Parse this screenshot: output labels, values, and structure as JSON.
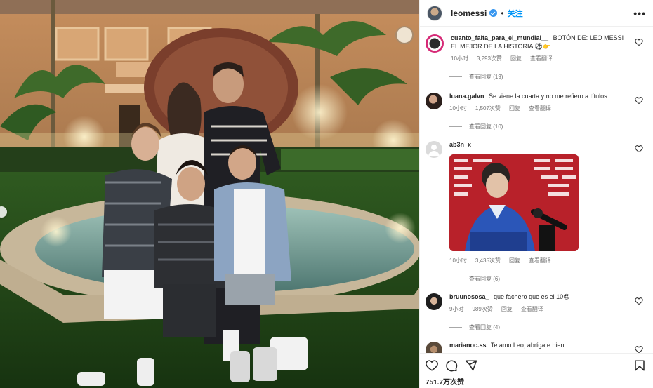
{
  "post": {
    "username": "leomessi",
    "follow_label": "关注",
    "more_label": "•••"
  },
  "comments": [
    {
      "username": "cuanto_falta_para_el_mundial__",
      "text": "BOTÓN DE: LEO MESSI EL MEJOR DE LA HISTORIA ⚽👉",
      "time": "10小时",
      "likes": "3,293次赞",
      "reply_label": "回复",
      "translate_label": "查看翻译",
      "view_replies": "查看回复 (19)"
    },
    {
      "username": "luana.galvn",
      "text": "Se viene la cuarta y no me refiero a títulos",
      "time": "10小时",
      "likes": "1,507次赞",
      "reply_label": "回复",
      "translate_label": "查看翻译",
      "view_replies": "查看回复 (10)"
    },
    {
      "username": "ab3n_x",
      "text": "",
      "time": "10小时",
      "likes": "3,435次赞",
      "reply_label": "回复",
      "translate_label": "查看翻译",
      "view_replies": "查看回复 (6)"
    },
    {
      "username": "bruunososa_",
      "text": "que fachero que es el 10😍",
      "time": "9小时",
      "likes": "989次赞",
      "reply_label": "回复",
      "translate_label": "查看翻译",
      "view_replies": "查看回复 (4)"
    },
    {
      "username": "marianoc.ss",
      "text": "Te amo Leo, abrígate bien"
    }
  ],
  "footer": {
    "views": "751.7万次赞"
  },
  "icons": [
    "heart-icon",
    "comment-icon",
    "share-icon",
    "bookmark-icon",
    "verified-icon",
    "more-icon"
  ],
  "colors": {
    "accent": "#0095f6",
    "verified": "#3897f0",
    "text": "#262626",
    "meta": "#737373"
  }
}
